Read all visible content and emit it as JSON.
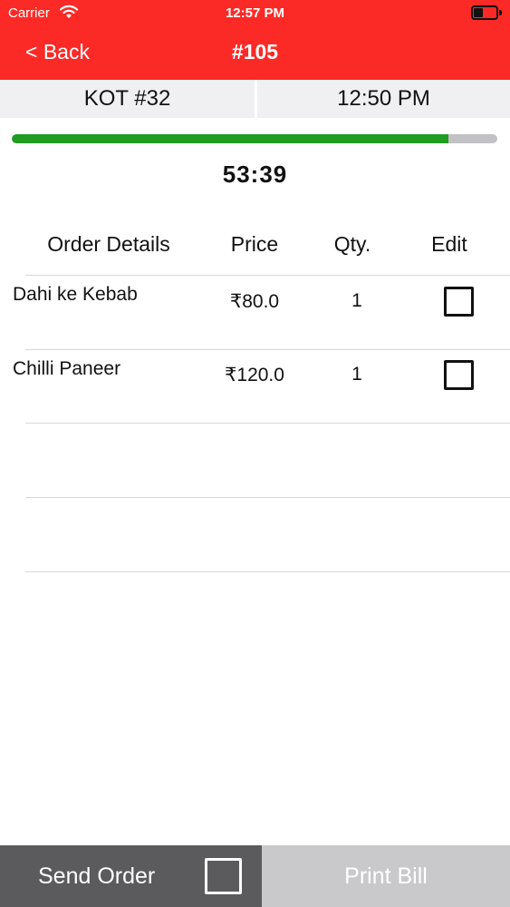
{
  "status_bar": {
    "carrier": "Carrier",
    "wifi_icon": "wifi-icon",
    "time": "12:57 PM",
    "battery_icon": "battery-icon"
  },
  "nav": {
    "back_label": "< Back",
    "title": "#105",
    "bar_color": "#fb2a26"
  },
  "kot": {
    "number": "KOT #32",
    "time": "12:50 PM"
  },
  "progress": {
    "fraction": 0.9,
    "fill_color": "#1f9c21"
  },
  "timer": "53:39",
  "table": {
    "headers": {
      "details": "Order Details",
      "price": "Price",
      "qty": "Qty.",
      "edit": "Edit"
    },
    "rows": [
      {
        "name": "Dahi ke Kebab",
        "price": "₹80.0",
        "qty": "1",
        "edit_checked": false
      },
      {
        "name": "Chilli Paneer",
        "price": "₹120.0",
        "qty": "1",
        "edit_checked": false
      }
    ]
  },
  "footer": {
    "send_label": "Send Order",
    "send_checked": false,
    "print_label": "Print Bill"
  }
}
